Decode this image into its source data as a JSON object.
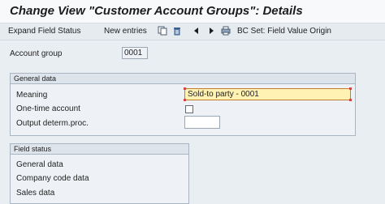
{
  "window": {
    "title": "Change View \"Customer Account Groups\": Details"
  },
  "toolbar": {
    "expand_label": "Expand Field Status",
    "new_entries_label": "New entries",
    "bc_set_label": "BC Set: Field Value Origin"
  },
  "account_group": {
    "label": "Account group",
    "value": "0001"
  },
  "general_data": {
    "header": "General data",
    "meaning_label": "Meaning",
    "meaning_value": "Sold-to party - 0001",
    "one_time_label": "One-time account",
    "output_label": "Output determ.proc.",
    "output_value": ""
  },
  "field_status": {
    "header": "Field status",
    "items": [
      "General data",
      "Company code data",
      "Sales data"
    ]
  }
}
